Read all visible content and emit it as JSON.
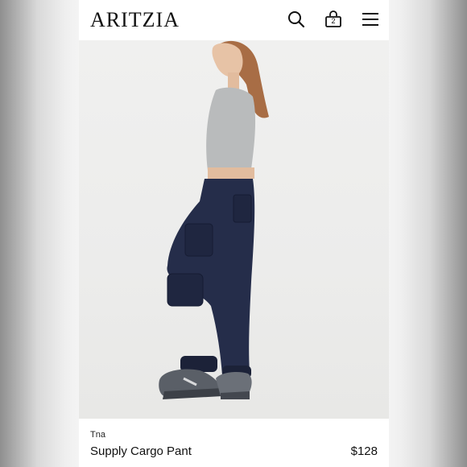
{
  "header": {
    "logo": "ARITZIA",
    "search_icon": "search-icon",
    "bag_icon": "shopping-bag-icon",
    "bag_count": "2",
    "menu_icon": "hamburger-menu-icon"
  },
  "product": {
    "brand": "Tna",
    "name": "Supply Cargo Pant",
    "price": "$128"
  },
  "colors": {
    "pant_navy": "#252d4a",
    "top_grey": "#b9bbbc",
    "background": "#ffffff"
  }
}
